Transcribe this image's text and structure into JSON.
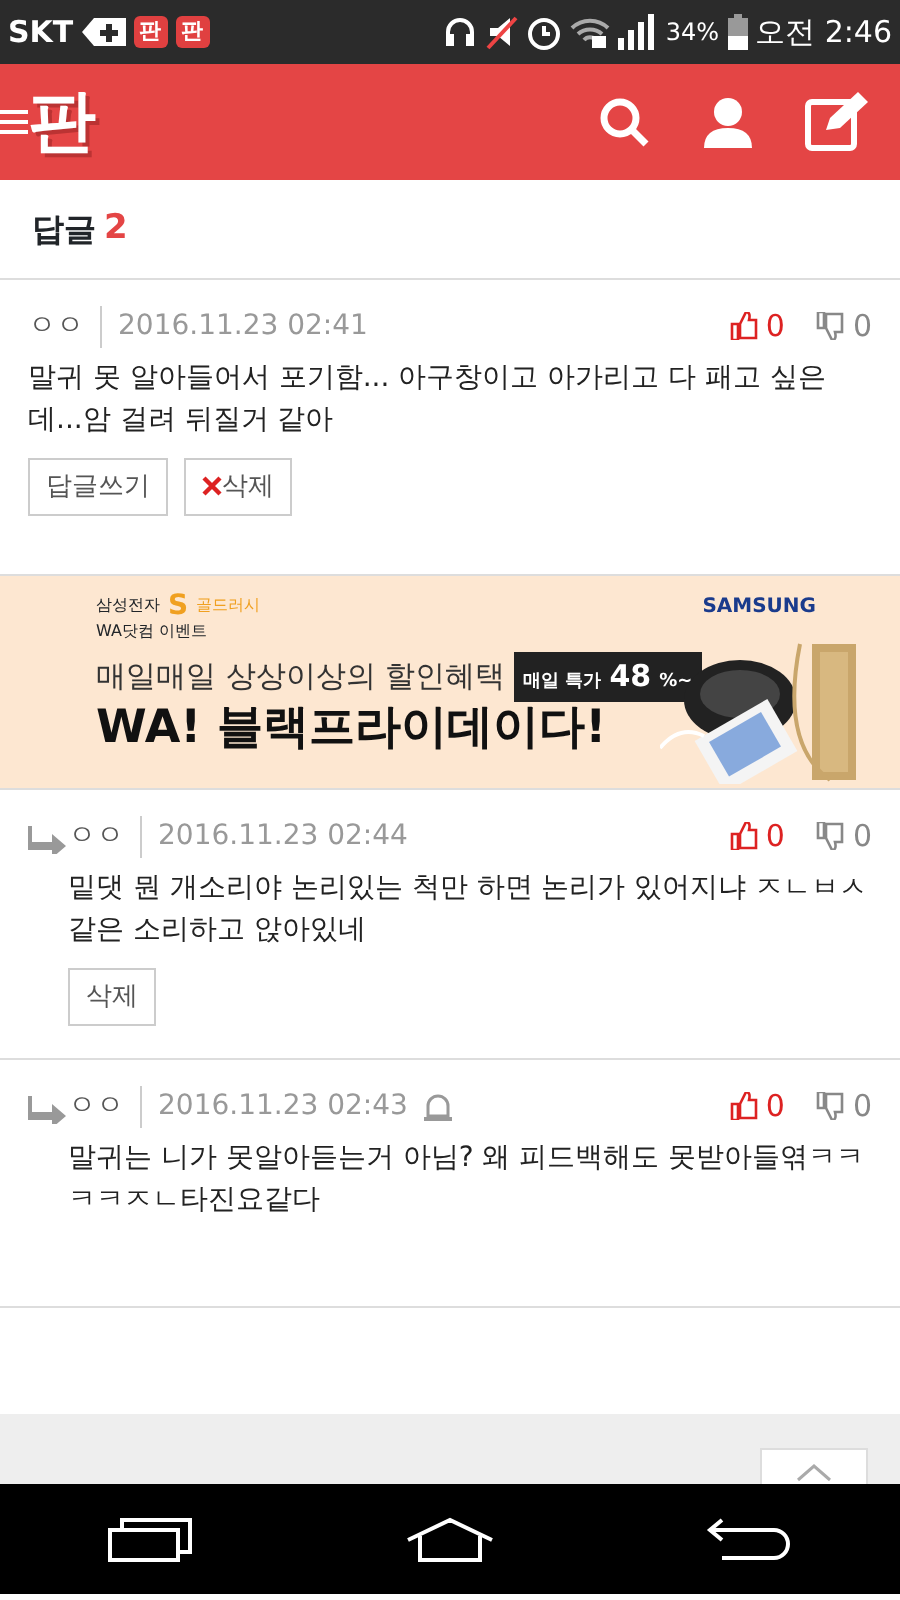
{
  "status_bar": {
    "carrier": "SKT",
    "app_icons": [
      "판",
      "판"
    ],
    "battery": "34%",
    "time": "오전 2:46"
  },
  "header": {
    "logo": "판"
  },
  "replies_header": {
    "label": "답글",
    "count": "2"
  },
  "comments": [
    {
      "kind": "comment",
      "author": "ㅇㅇ",
      "date": "2016.11.23 02:41",
      "bell": false,
      "likes": "0",
      "dislikes": "0",
      "text": "말귀 못 알아들어서 포기함... 아구창이고 아가리고 다 패고 싶은데...암 걸려 뒤질거 같아",
      "buttons": [
        {
          "label": "답글쓰기",
          "kind": "reply"
        },
        {
          "label": "삭제",
          "kind": "delete"
        }
      ]
    },
    {
      "kind": "ad",
      "small_brand": "삼성전자",
      "s_mark": "S",
      "gold": "골드러시",
      "event": "WA닷컴 이벤트",
      "line1": "매일매일 상상이상의 할인혜택",
      "tag_label": "매일 특가",
      "tag_value": "48",
      "tag_unit": "%~",
      "brand": "SAMSUNG",
      "headline": "WA! 블랙프라이데이다!"
    },
    {
      "kind": "reply",
      "author": "ㅇㅇ",
      "date": "2016.11.23 02:44",
      "bell": false,
      "likes": "0",
      "dislikes": "0",
      "text": "밑댓 뭔 개소리야 논리있는 척만 하면 논리가 있어지냐 ㅈㄴㅂㅅ같은 소리하고 앉아있네",
      "buttons": [
        {
          "label": "삭제",
          "kind": "plain"
        }
      ]
    },
    {
      "kind": "reply",
      "author": "ㅇㅇ",
      "date": "2016.11.23 02:43",
      "bell": true,
      "likes": "0",
      "dislikes": "0",
      "text": "말귀는 니가 못알아듣는거 아님? 왜 피드백해도 못받아들엮ㅋㅋㅋㅋㅈㄴ타진요같다"
    }
  ]
}
